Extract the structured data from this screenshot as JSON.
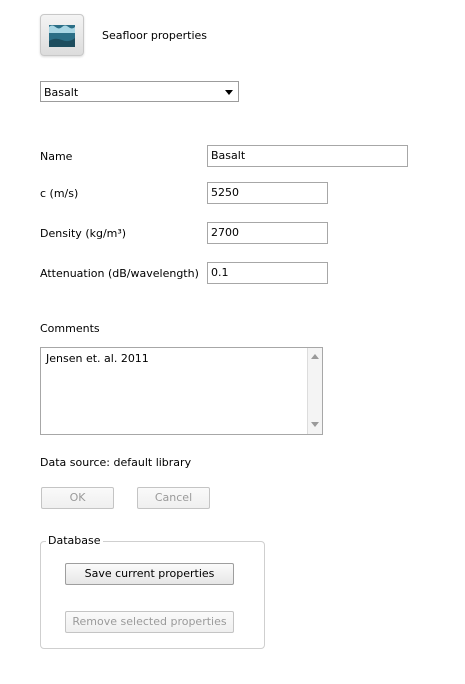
{
  "header": {
    "title": "Seafloor properties",
    "icon": "seafloor-icon"
  },
  "preset": {
    "selected": "Basalt"
  },
  "form": {
    "name_label": "Name",
    "name_value": "Basalt",
    "speed_label": "c (m/s)",
    "speed_value": "5250",
    "density_label": "Density (kg/m³)",
    "density_value": "2700",
    "attenuation_label": "Attenuation (dB/wavelength)",
    "attenuation_value": "0.1"
  },
  "comments": {
    "label": "Comments",
    "text": "Jensen et. al. 2011"
  },
  "data_source": "Data source: default library",
  "actions": {
    "ok_label": "OK",
    "cancel_label": "Cancel"
  },
  "database": {
    "title": "Database",
    "save_label": "Save current properties",
    "remove_label": "Remove selected properties"
  },
  "colors": {
    "icon_water": "#2b6e86",
    "icon_floor": "#1d4d5e"
  }
}
